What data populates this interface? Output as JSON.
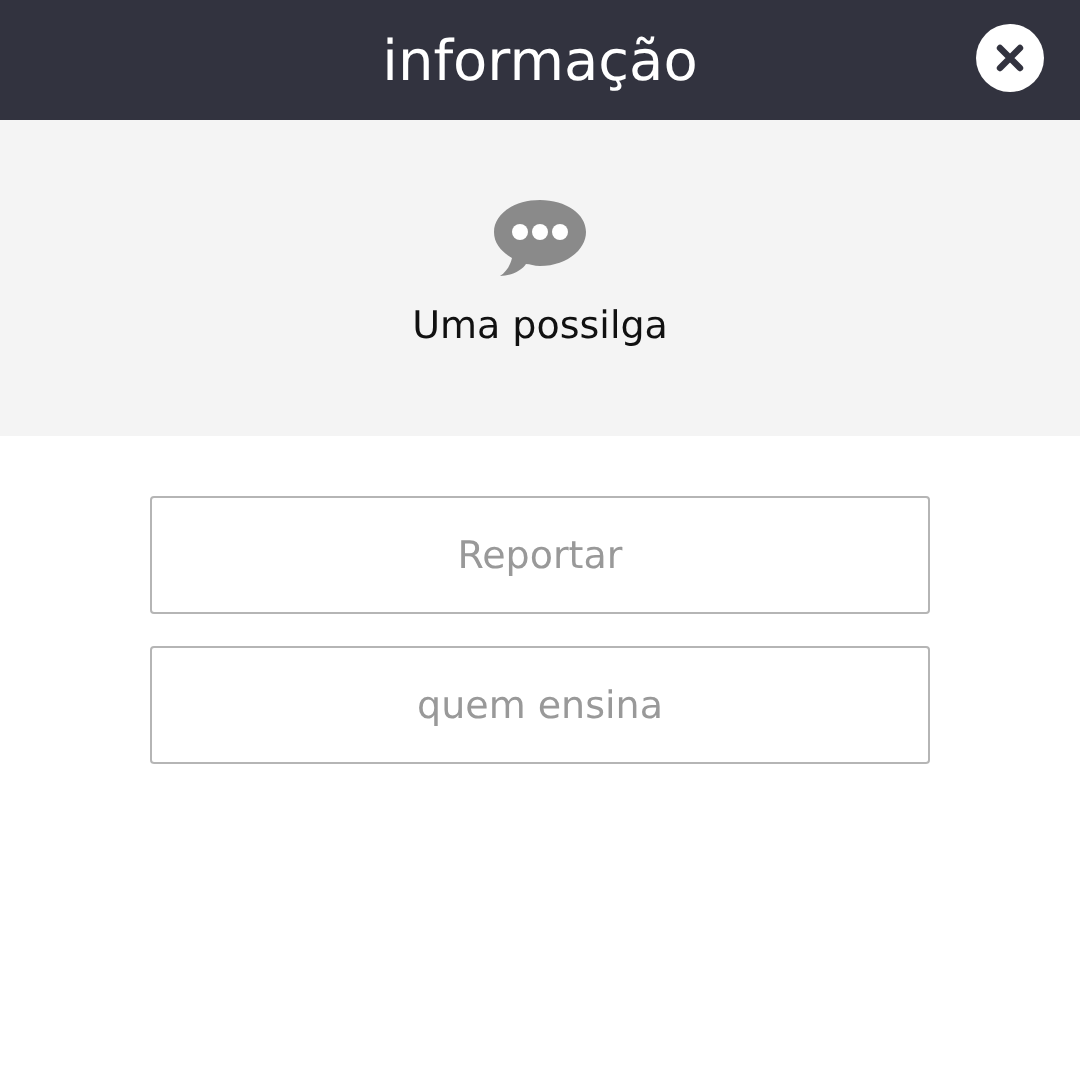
{
  "header": {
    "title": "informação"
  },
  "message": {
    "text": "Uma possilga"
  },
  "buttons": [
    "Reportar",
    "quem ensina"
  ]
}
